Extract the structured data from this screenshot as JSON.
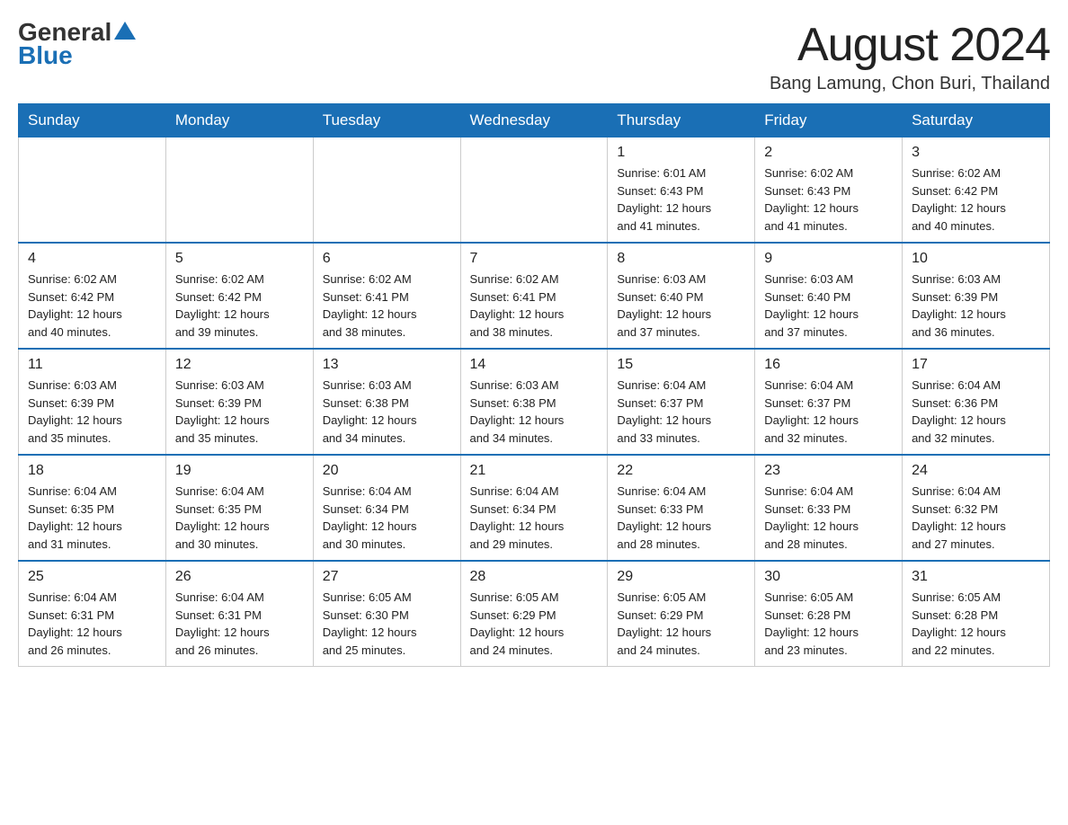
{
  "header": {
    "logo_general": "General",
    "logo_blue": "Blue",
    "month_title": "August 2024",
    "location": "Bang Lamung, Chon Buri, Thailand"
  },
  "weekdays": [
    "Sunday",
    "Monday",
    "Tuesday",
    "Wednesday",
    "Thursday",
    "Friday",
    "Saturday"
  ],
  "weeks": [
    [
      {
        "day": "",
        "info": ""
      },
      {
        "day": "",
        "info": ""
      },
      {
        "day": "",
        "info": ""
      },
      {
        "day": "",
        "info": ""
      },
      {
        "day": "1",
        "info": "Sunrise: 6:01 AM\nSunset: 6:43 PM\nDaylight: 12 hours\nand 41 minutes."
      },
      {
        "day": "2",
        "info": "Sunrise: 6:02 AM\nSunset: 6:43 PM\nDaylight: 12 hours\nand 41 minutes."
      },
      {
        "day": "3",
        "info": "Sunrise: 6:02 AM\nSunset: 6:42 PM\nDaylight: 12 hours\nand 40 minutes."
      }
    ],
    [
      {
        "day": "4",
        "info": "Sunrise: 6:02 AM\nSunset: 6:42 PM\nDaylight: 12 hours\nand 40 minutes."
      },
      {
        "day": "5",
        "info": "Sunrise: 6:02 AM\nSunset: 6:42 PM\nDaylight: 12 hours\nand 39 minutes."
      },
      {
        "day": "6",
        "info": "Sunrise: 6:02 AM\nSunset: 6:41 PM\nDaylight: 12 hours\nand 38 minutes."
      },
      {
        "day": "7",
        "info": "Sunrise: 6:02 AM\nSunset: 6:41 PM\nDaylight: 12 hours\nand 38 minutes."
      },
      {
        "day": "8",
        "info": "Sunrise: 6:03 AM\nSunset: 6:40 PM\nDaylight: 12 hours\nand 37 minutes."
      },
      {
        "day": "9",
        "info": "Sunrise: 6:03 AM\nSunset: 6:40 PM\nDaylight: 12 hours\nand 37 minutes."
      },
      {
        "day": "10",
        "info": "Sunrise: 6:03 AM\nSunset: 6:39 PM\nDaylight: 12 hours\nand 36 minutes."
      }
    ],
    [
      {
        "day": "11",
        "info": "Sunrise: 6:03 AM\nSunset: 6:39 PM\nDaylight: 12 hours\nand 35 minutes."
      },
      {
        "day": "12",
        "info": "Sunrise: 6:03 AM\nSunset: 6:39 PM\nDaylight: 12 hours\nand 35 minutes."
      },
      {
        "day": "13",
        "info": "Sunrise: 6:03 AM\nSunset: 6:38 PM\nDaylight: 12 hours\nand 34 minutes."
      },
      {
        "day": "14",
        "info": "Sunrise: 6:03 AM\nSunset: 6:38 PM\nDaylight: 12 hours\nand 34 minutes."
      },
      {
        "day": "15",
        "info": "Sunrise: 6:04 AM\nSunset: 6:37 PM\nDaylight: 12 hours\nand 33 minutes."
      },
      {
        "day": "16",
        "info": "Sunrise: 6:04 AM\nSunset: 6:37 PM\nDaylight: 12 hours\nand 32 minutes."
      },
      {
        "day": "17",
        "info": "Sunrise: 6:04 AM\nSunset: 6:36 PM\nDaylight: 12 hours\nand 32 minutes."
      }
    ],
    [
      {
        "day": "18",
        "info": "Sunrise: 6:04 AM\nSunset: 6:35 PM\nDaylight: 12 hours\nand 31 minutes."
      },
      {
        "day": "19",
        "info": "Sunrise: 6:04 AM\nSunset: 6:35 PM\nDaylight: 12 hours\nand 30 minutes."
      },
      {
        "day": "20",
        "info": "Sunrise: 6:04 AM\nSunset: 6:34 PM\nDaylight: 12 hours\nand 30 minutes."
      },
      {
        "day": "21",
        "info": "Sunrise: 6:04 AM\nSunset: 6:34 PM\nDaylight: 12 hours\nand 29 minutes."
      },
      {
        "day": "22",
        "info": "Sunrise: 6:04 AM\nSunset: 6:33 PM\nDaylight: 12 hours\nand 28 minutes."
      },
      {
        "day": "23",
        "info": "Sunrise: 6:04 AM\nSunset: 6:33 PM\nDaylight: 12 hours\nand 28 minutes."
      },
      {
        "day": "24",
        "info": "Sunrise: 6:04 AM\nSunset: 6:32 PM\nDaylight: 12 hours\nand 27 minutes."
      }
    ],
    [
      {
        "day": "25",
        "info": "Sunrise: 6:04 AM\nSunset: 6:31 PM\nDaylight: 12 hours\nand 26 minutes."
      },
      {
        "day": "26",
        "info": "Sunrise: 6:04 AM\nSunset: 6:31 PM\nDaylight: 12 hours\nand 26 minutes."
      },
      {
        "day": "27",
        "info": "Sunrise: 6:05 AM\nSunset: 6:30 PM\nDaylight: 12 hours\nand 25 minutes."
      },
      {
        "day": "28",
        "info": "Sunrise: 6:05 AM\nSunset: 6:29 PM\nDaylight: 12 hours\nand 24 minutes."
      },
      {
        "day": "29",
        "info": "Sunrise: 6:05 AM\nSunset: 6:29 PM\nDaylight: 12 hours\nand 24 minutes."
      },
      {
        "day": "30",
        "info": "Sunrise: 6:05 AM\nSunset: 6:28 PM\nDaylight: 12 hours\nand 23 minutes."
      },
      {
        "day": "31",
        "info": "Sunrise: 6:05 AM\nSunset: 6:28 PM\nDaylight: 12 hours\nand 22 minutes."
      }
    ]
  ]
}
